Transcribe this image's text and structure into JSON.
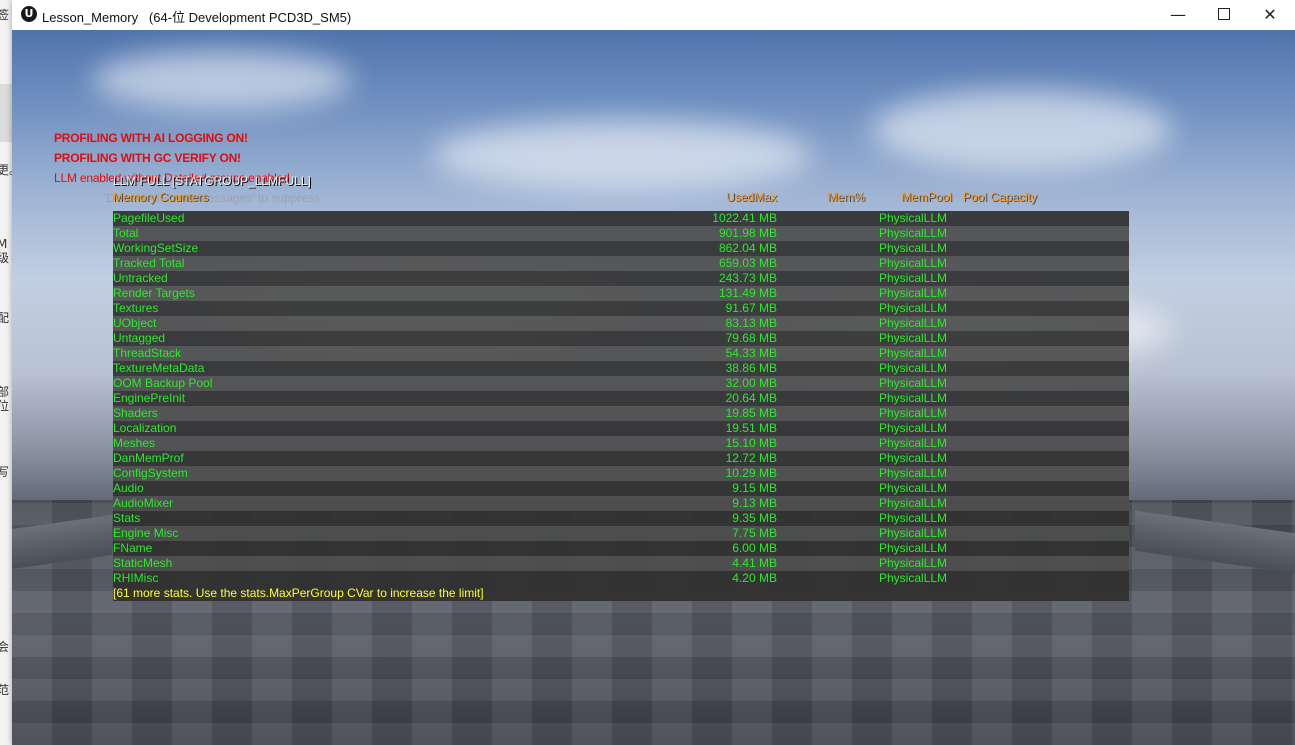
{
  "background_app": {
    "glyphs": [
      "签",
      "更。",
      "M级",
      "配",
      "部位",
      "写",
      "会",
      "范"
    ]
  },
  "window": {
    "title": "Lesson_Memory   (64-位 Development PCD3D_SM5)",
    "logo": "U",
    "minimize_glyph": "—",
    "close_glyph": "✕"
  },
  "debug_messages": {
    "line1": "PROFILING WITH AI LOGGING ON!",
    "line2": "PROFILING WITH GC VERIFY ON!",
    "line3": "LLM enabled without Detailed groups enabled",
    "hint": "'DisableAllScreenMessages' to suppress"
  },
  "stats": {
    "title": "LLM FULL [STATGROUP_LLMFULL]",
    "headers": {
      "name": "Memory Counters",
      "used_max": "UsedMax",
      "mem_pct": "Mem%",
      "mem_pool": "MemPool",
      "pool_capacity": "Pool Capacity"
    },
    "rows": [
      {
        "name": "PagefileUsed",
        "used": "1022.41 MB",
        "pool": "PhysicalLLM"
      },
      {
        "name": "Total",
        "used": "901.98 MB",
        "pool": "PhysicalLLM"
      },
      {
        "name": "WorkingSetSize",
        "used": "862.04 MB",
        "pool": "PhysicalLLM"
      },
      {
        "name": "Tracked Total",
        "used": "659.03 MB",
        "pool": "PhysicalLLM"
      },
      {
        "name": "Untracked",
        "used": "243.73 MB",
        "pool": "PhysicalLLM"
      },
      {
        "name": "Render Targets",
        "used": "131.49 MB",
        "pool": "PhysicalLLM"
      },
      {
        "name": "Textures",
        "used": "91.67 MB",
        "pool": "PhysicalLLM"
      },
      {
        "name": "UObject",
        "used": "83.13 MB",
        "pool": "PhysicalLLM"
      },
      {
        "name": "Untagged",
        "used": "79.68 MB",
        "pool": "PhysicalLLM"
      },
      {
        "name": "ThreadStack",
        "used": "54.33 MB",
        "pool": "PhysicalLLM"
      },
      {
        "name": "TextureMetaData",
        "used": "38.86 MB",
        "pool": "PhysicalLLM"
      },
      {
        "name": "OOM Backup Pool",
        "used": "32.00 MB",
        "pool": "PhysicalLLM"
      },
      {
        "name": "EnginePreInit",
        "used": "20.64 MB",
        "pool": "PhysicalLLM"
      },
      {
        "name": "Shaders",
        "used": "19.85 MB",
        "pool": "PhysicalLLM"
      },
      {
        "name": "Localization",
        "used": "19.51 MB",
        "pool": "PhysicalLLM"
      },
      {
        "name": "Meshes",
        "used": "15.10 MB",
        "pool": "PhysicalLLM"
      },
      {
        "name": "DanMemProf",
        "used": "12.72 MB",
        "pool": "PhysicalLLM"
      },
      {
        "name": "ConfigSystem",
        "used": "10.29 MB",
        "pool": "PhysicalLLM"
      },
      {
        "name": "Audio",
        "used": "9.15 MB",
        "pool": "PhysicalLLM"
      },
      {
        "name": "AudioMixer",
        "used": "9.13 MB",
        "pool": "PhysicalLLM"
      },
      {
        "name": "Stats",
        "used": "9.35 MB",
        "pool": "PhysicalLLM"
      },
      {
        "name": "Engine Misc",
        "used": "7.75 MB",
        "pool": "PhysicalLLM"
      },
      {
        "name": "FName",
        "used": "6.00 MB",
        "pool": "PhysicalLLM"
      },
      {
        "name": "StaticMesh",
        "used": "4.41 MB",
        "pool": "PhysicalLLM"
      },
      {
        "name": "RHIMisc",
        "used": "4.20 MB",
        "pool": "PhysicalLLM"
      }
    ],
    "more_note": "[61 more stats. Use the stats.MaxPerGroup CVar to increase the limit]"
  },
  "colors": {
    "counter_text": "#2bea2b",
    "header_text": "#ff9b1e",
    "warning_text": "#e00d0d",
    "note_text": "#ffff2a"
  }
}
